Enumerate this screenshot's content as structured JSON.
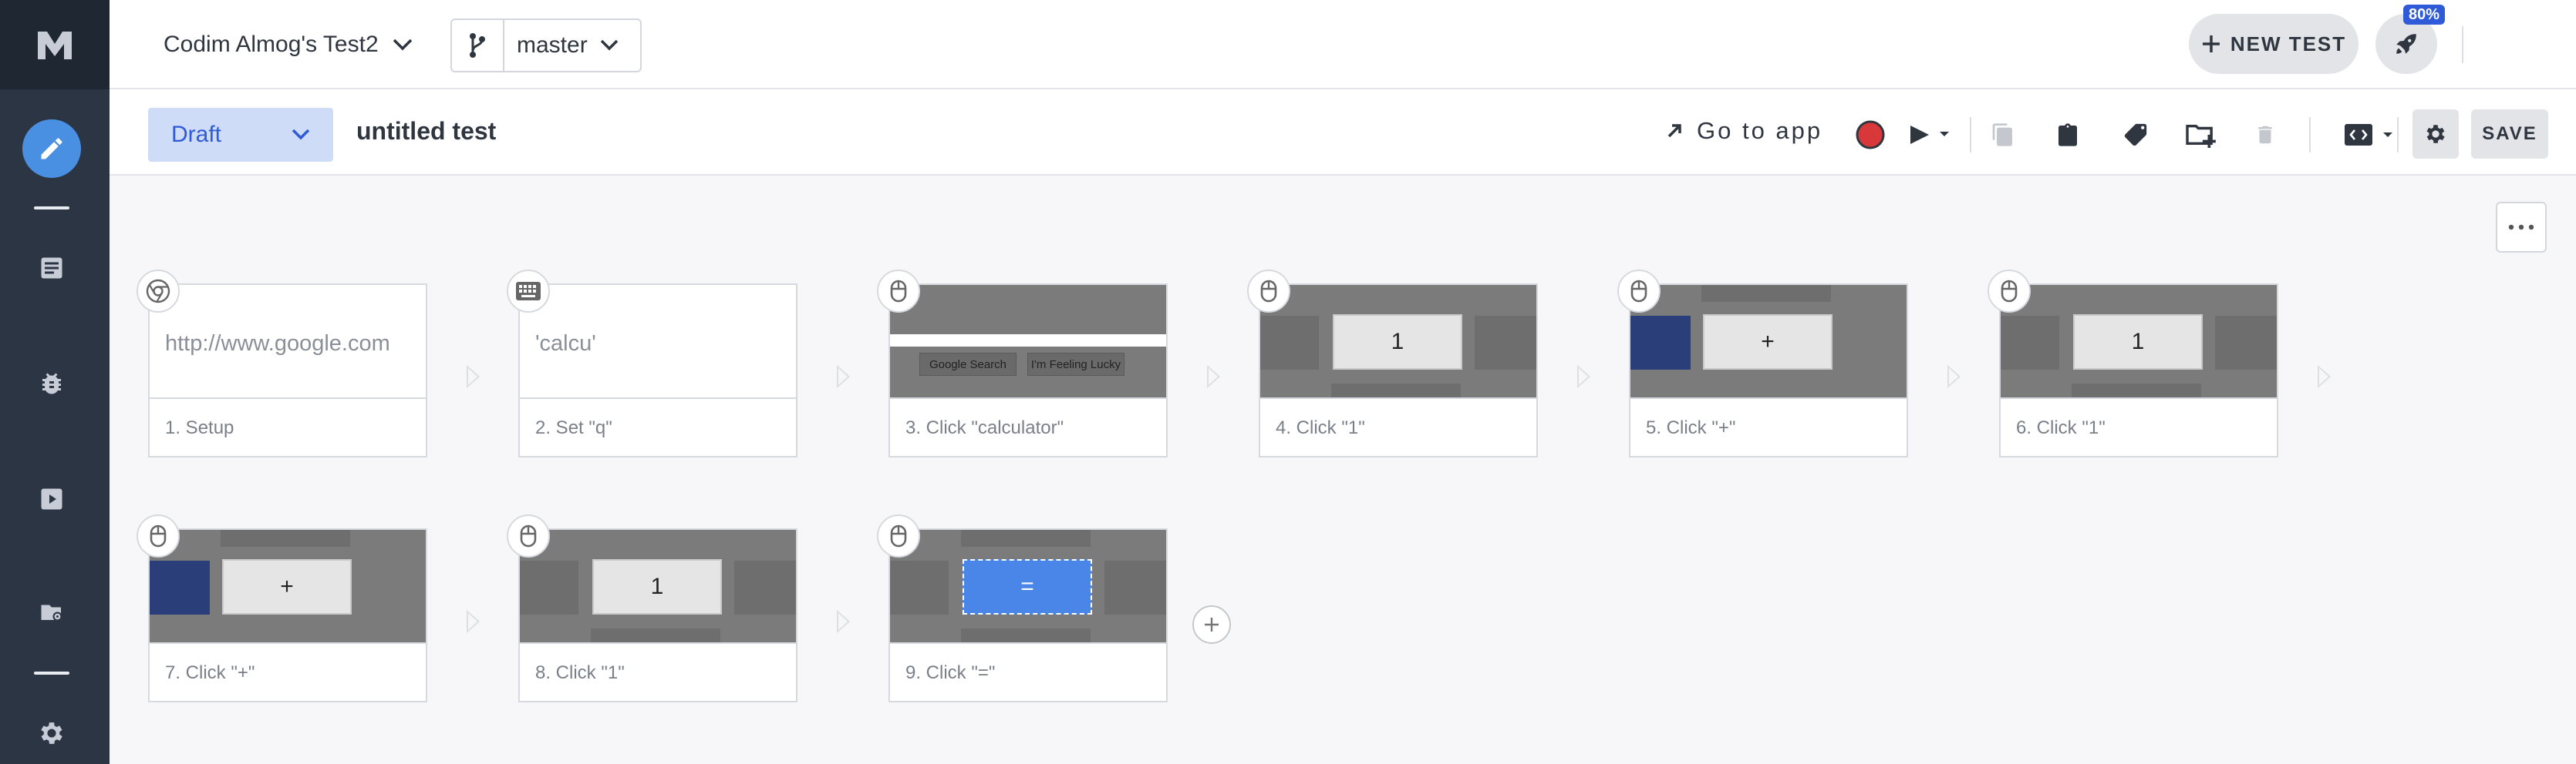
{
  "header": {
    "project_name": "Codim Almog's Test2",
    "branch": "master",
    "new_test_label": "NEW TEST",
    "notification_badge": "80%"
  },
  "sidebar": {
    "items": [
      {
        "name": "edit",
        "icon": "pencil-icon",
        "active": true
      },
      {
        "name": "tests",
        "icon": "list-icon"
      },
      {
        "name": "bugs",
        "icon": "bug-icon"
      },
      {
        "name": "runs",
        "icon": "play-icon"
      },
      {
        "name": "settings-folder",
        "icon": "folder-gear-icon"
      },
      {
        "name": "settings",
        "icon": "gear-icon"
      }
    ]
  },
  "toolbar": {
    "status": "Draft",
    "test_name": "untitled test",
    "go_to_app_label": "Go to app",
    "save_label": "SAVE"
  },
  "steps": [
    {
      "label": "1. Setup",
      "text": "http://www.google.com",
      "icon": "chrome-icon"
    },
    {
      "label": "2. Set \"q\"",
      "text": "'calcu'",
      "icon": "keyboard-icon"
    },
    {
      "label": "3. Click \"calculator\"",
      "google_search": "Google Search",
      "feeling_lucky": "I'm Feeling Lucky",
      "icon": "mouse-icon"
    },
    {
      "label": "4. Click \"1\"",
      "key": "1",
      "icon": "mouse-icon"
    },
    {
      "label": "5. Click \"+\"",
      "key": "+",
      "icon": "mouse-icon"
    },
    {
      "label": "6. Click \"1\"",
      "key": "1",
      "icon": "mouse-icon"
    },
    {
      "label": "7. Click \"+\"",
      "key": "+",
      "icon": "mouse-icon"
    },
    {
      "label": "8. Click \"1\"",
      "key": "1",
      "icon": "mouse-icon"
    },
    {
      "label": "9. Click \"=\"",
      "key": "=",
      "icon": "mouse-icon"
    }
  ],
  "colors": {
    "sidebar": "#2c3544",
    "accent": "#4a90e2",
    "draft_bg": "#cfdcf7",
    "draft_text": "#2f5bd8",
    "record": "#d9383a"
  }
}
